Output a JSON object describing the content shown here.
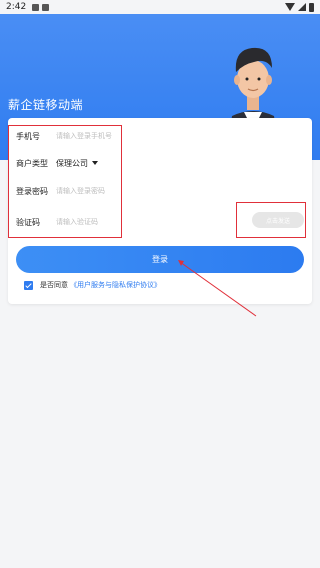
{
  "status_bar": {
    "time": "2:42"
  },
  "app": {
    "title": "薪企链移动端"
  },
  "form": {
    "phone": {
      "label": "手机号",
      "placeholder": "请输入登录手机号"
    },
    "merchant_type": {
      "label": "商户类型",
      "value": "保理公司"
    },
    "password": {
      "label": "登录密码",
      "placeholder": "请输入登录密码"
    },
    "code": {
      "label": "验证码",
      "placeholder": "请输入验证码",
      "send_label": "点击发送"
    }
  },
  "login_button": "登录",
  "agreement": {
    "checked": true,
    "prefix": "是否同意",
    "link": "《用户服务与隐私保护协议》"
  },
  "colors": {
    "primary": "#2f7cf0",
    "annotation": "#e0303a"
  }
}
